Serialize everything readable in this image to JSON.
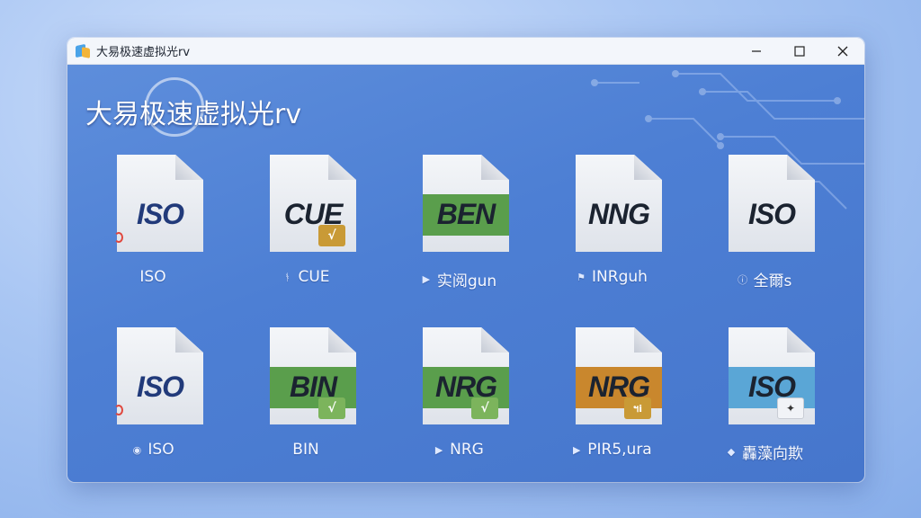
{
  "window": {
    "title": "大易极速虚拟光rv",
    "controls": {
      "minimize": "minimize-icon",
      "maximize": "maximize-icon",
      "close": "close-icon"
    }
  },
  "header": {
    "app_name": "大易极速虚拟光rv"
  },
  "colors": {
    "window_bg": "#4d7fd4",
    "green_band": "#5a9e4c",
    "blue_band": "#5aa6d6",
    "orange_band": "#c9872d",
    "badge_gold": "#c99a36",
    "badge_green": "#7cb45c"
  },
  "items": [
    {
      "label": "ISO",
      "caption": "ISO",
      "caption_icon": "",
      "badge": ""
    },
    {
      "label": "CUE",
      "caption": "CUE",
      "caption_icon": "plug-icon",
      "badge": "√"
    },
    {
      "label": "BEN",
      "caption": "实阅gun",
      "caption_icon": "play-icon",
      "badge": ""
    },
    {
      "label": "NNG",
      "caption": "INRguh",
      "caption_icon": "flag-icon",
      "badge": ""
    },
    {
      "label": "ISO",
      "caption": "全爾s",
      "caption_icon": "info-icon",
      "badge": ""
    },
    {
      "label": "ISO",
      "caption": "ISO",
      "caption_icon": "disc-icon",
      "badge": ""
    },
    {
      "label": "BIN",
      "caption": "BIN",
      "caption_icon": "",
      "badge": "√"
    },
    {
      "label": "NRG",
      "caption": "NRG",
      "caption_icon": "play-icon",
      "badge": "√"
    },
    {
      "label": "NRG",
      "caption": "PIR5,ura",
      "caption_icon": "play-icon",
      "badge": "ฯi"
    },
    {
      "label": "ISO",
      "caption": "轟藻向欺",
      "caption_icon": "diamond-icon",
      "badge": ""
    }
  ]
}
